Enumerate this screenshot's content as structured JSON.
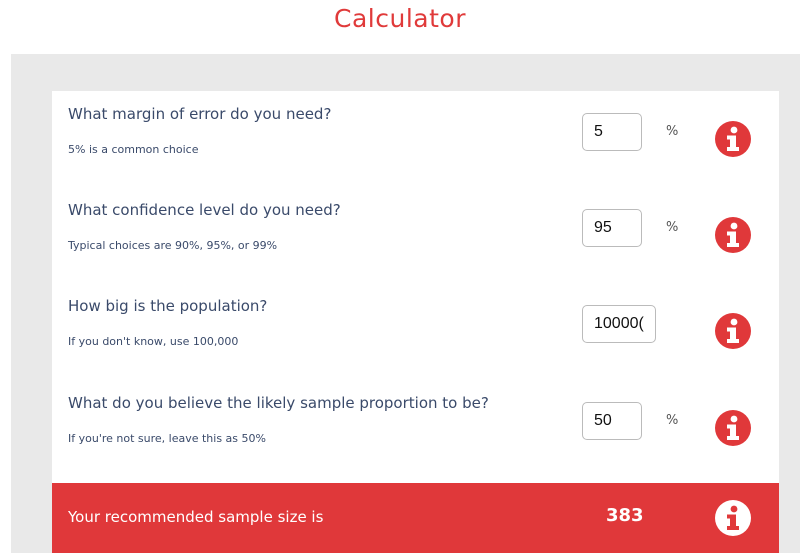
{
  "page": {
    "title": "Calculator",
    "accent_color": "#e0383a"
  },
  "questions": [
    {
      "question": "What margin of error do you need?",
      "hint": "5% is a common choice",
      "value": "5",
      "unit": "%"
    },
    {
      "question": "What confidence level do you need?",
      "hint": "Typical choices are 90%, 95%, or 99%",
      "value": "95",
      "unit": "%"
    },
    {
      "question": "How big is the population?",
      "hint": "If you don't know, use 100,000",
      "value": "10000(",
      "unit": ""
    },
    {
      "question": "What do you believe the likely sample proportion to be?",
      "hint": "If you're not sure, leave this as 50%",
      "value": "50",
      "unit": "%"
    }
  ],
  "result": {
    "label": "Your recommended sample size is",
    "value": "383"
  },
  "icons": {
    "info": "info-icon"
  }
}
